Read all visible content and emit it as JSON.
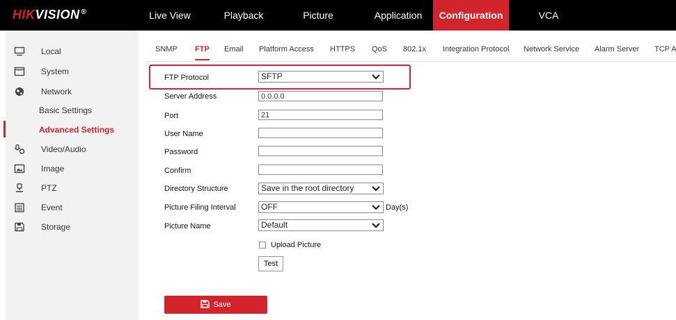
{
  "brand": {
    "hik": "HIK",
    "vision": "VISION",
    "reg": "®"
  },
  "nav": {
    "live_view": "Live View",
    "playback": "Playback",
    "picture": "Picture",
    "application": "Application",
    "configuration": "Configuration",
    "vca": "VCA"
  },
  "sidebar": {
    "local": "Local",
    "system": "System",
    "network": "Network",
    "basic_settings": "Basic Settings",
    "advanced_settings": "Advanced Settings",
    "video_audio": "Video/Audio",
    "image": "Image",
    "ptz": "PTZ",
    "event": "Event",
    "storage": "Storage"
  },
  "tabs": {
    "snmp": "SNMP",
    "ftp": "FTP",
    "email": "Email",
    "platform_access": "Platform Access",
    "https": "HTTPS",
    "qos": "QoS",
    "dot1x": "802.1x",
    "integration_protocol": "Integration Protocol",
    "network_service": "Network Service",
    "alarm_server": "Alarm Server",
    "tcp": "TCP A"
  },
  "form": {
    "ftp_protocol": {
      "label": "FTP Protocol",
      "value": "SFTP"
    },
    "server_address": {
      "label": "Server Address",
      "value": "0.0.0.0"
    },
    "port": {
      "label": "Port",
      "value": "21"
    },
    "user_name": {
      "label": "User Name",
      "value": ""
    },
    "password": {
      "label": "Password",
      "value": ""
    },
    "confirm": {
      "label": "Confirm",
      "value": ""
    },
    "directory_structure": {
      "label": "Directory Structure",
      "value": "Save in the root directory"
    },
    "picture_filing_interval": {
      "label": "Picture Filing Interval",
      "value": "OFF",
      "unit": "Day(s)"
    },
    "picture_name": {
      "label": "Picture Name",
      "value": "Default"
    },
    "upload_picture": {
      "label": "Upload Picture",
      "checked": false
    },
    "test_label": "Test",
    "save_label": "Save"
  },
  "colors": {
    "accent": "#d2242b",
    "topbar": "#000000",
    "sidebar": "#f2f2f2",
    "highlight": "#e02127"
  }
}
